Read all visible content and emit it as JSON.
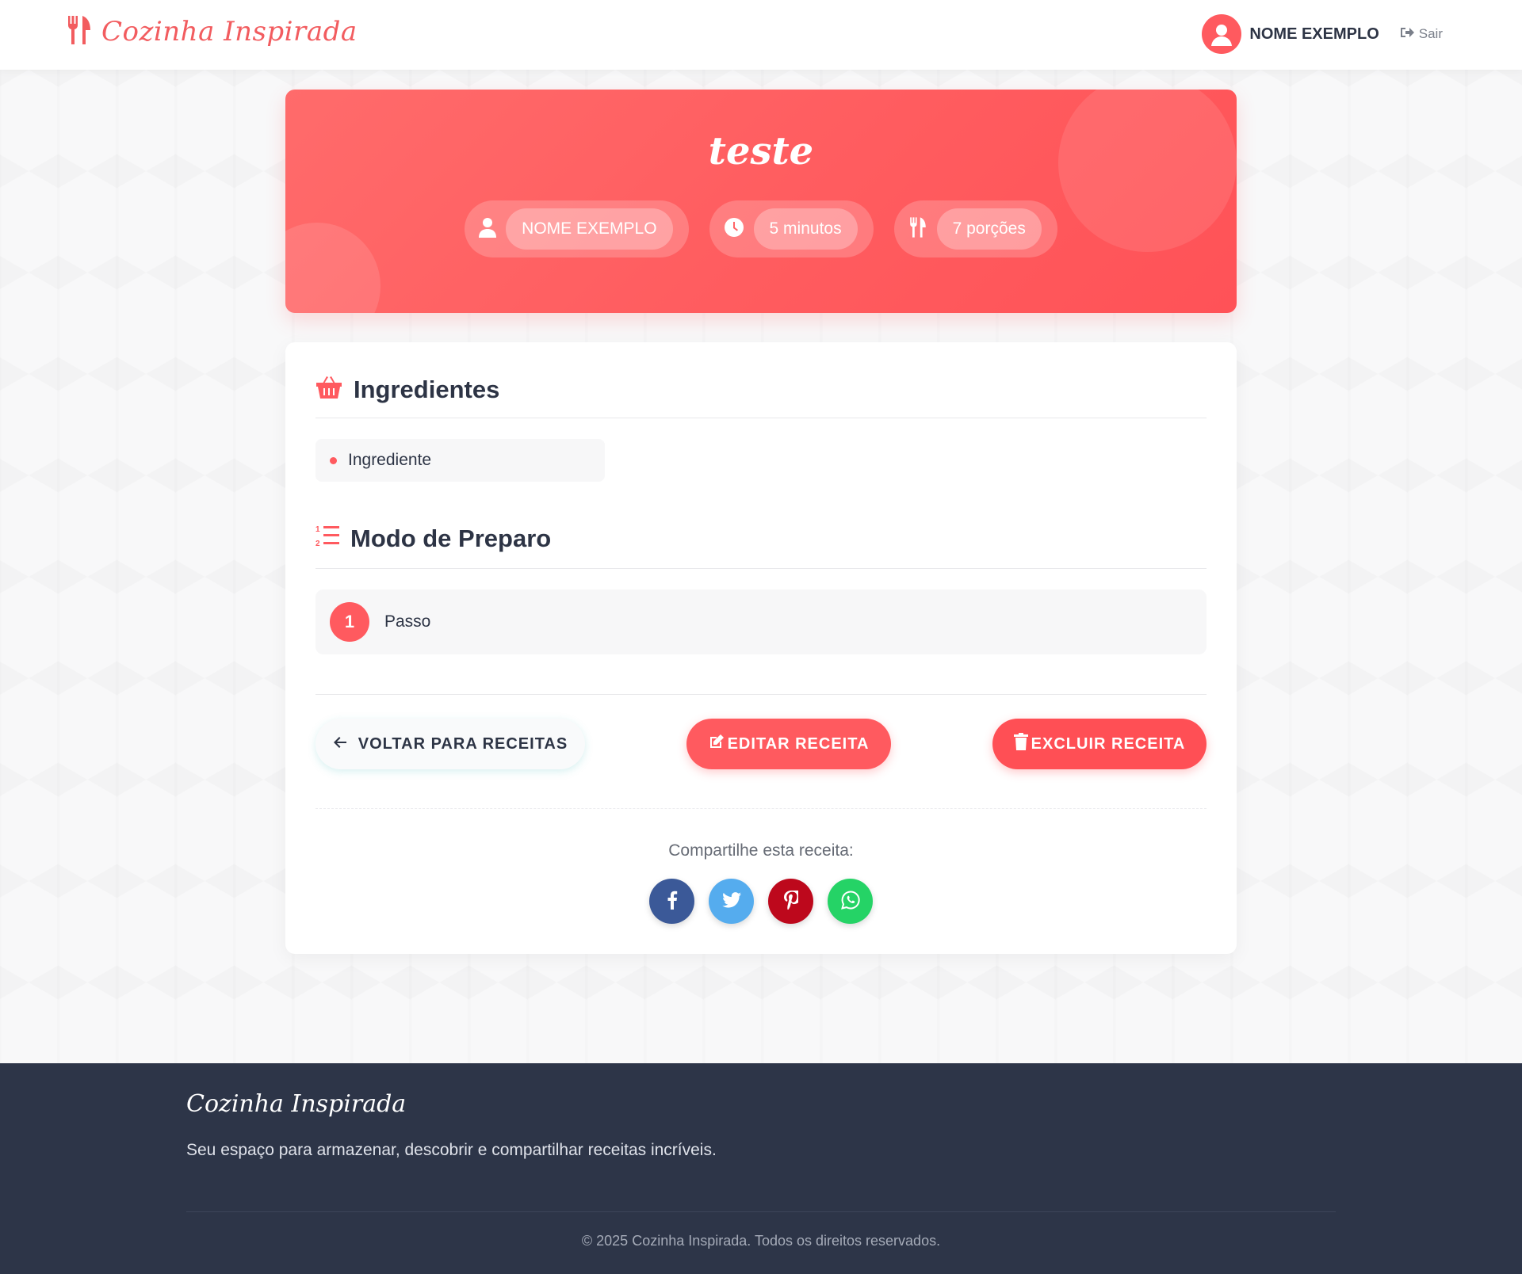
{
  "header": {
    "brand": "Cozinha Inspirada",
    "user_name": "NOME EXEMPLO",
    "logout_label": "Sair"
  },
  "recipe": {
    "title": "teste",
    "author": "NOME EXEMPLO",
    "time": "5 minutos",
    "servings": "7 porções"
  },
  "ingredients": {
    "heading": "Ingredientes",
    "items": [
      "Ingrediente"
    ]
  },
  "preparation": {
    "heading": "Modo de Preparo",
    "steps": [
      {
        "number": "1",
        "text": "Passo"
      }
    ]
  },
  "actions": {
    "back_label": "VOLTAR PARA RECEITAS",
    "edit_label": "EDITAR RECEITA",
    "delete_label": "EXCLUIR RECEITA"
  },
  "share": {
    "label": "Compartilhe esta receita:",
    "networks": [
      {
        "name": "facebook-icon",
        "color": "#3b5998"
      },
      {
        "name": "twitter-icon",
        "color": "#55acee"
      },
      {
        "name": "pinterest-icon",
        "color": "#bd081c"
      },
      {
        "name": "whatsapp-icon",
        "color": "#25d366"
      }
    ]
  },
  "footer": {
    "brand": "Cozinha Inspirada",
    "description": "Seu espaço para armazenar, descobrir e compartilhar receitas incríveis.",
    "copyright": "© 2025 Cozinha Inspirada. Todos os direitos reservados."
  },
  "colors": {
    "accent": "#ff5a5f",
    "footer_bg": "#2d3548",
    "text": "#2d3445"
  }
}
